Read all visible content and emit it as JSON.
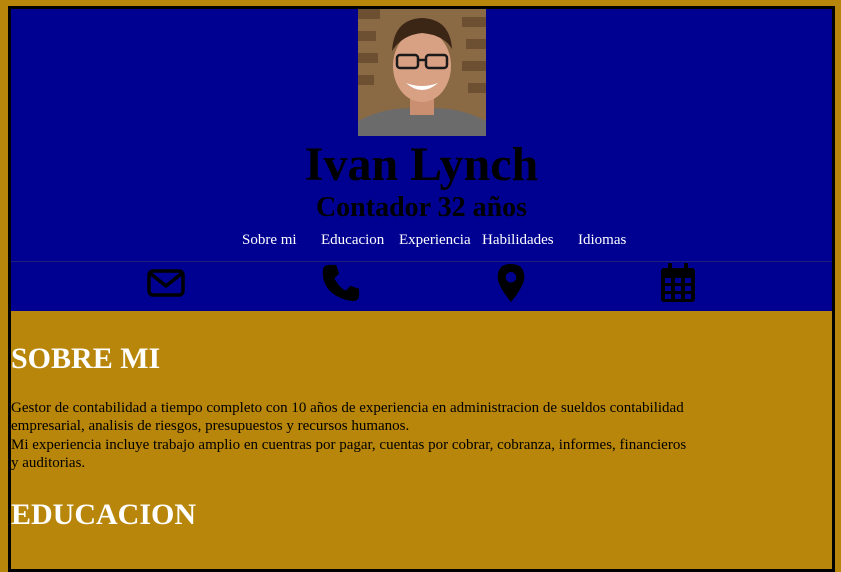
{
  "header": {
    "name": "Ivan Lynch",
    "role": "Contador 32 años"
  },
  "nav": {
    "items": [
      {
        "label": "Sobre mi"
      },
      {
        "label": "Educacion"
      },
      {
        "label": "Experiencia"
      },
      {
        "label": "Habilidades"
      },
      {
        "label": "Idiomas"
      }
    ]
  },
  "contact_icons": [
    "envelope-icon",
    "phone-icon",
    "location-pin-icon",
    "calendar-icon"
  ],
  "colors": {
    "page_background": "#b8860b",
    "header_background": "#000091",
    "section_title": "#ffffff",
    "nav_text": "#ffffff"
  },
  "sections": {
    "about": {
      "title": "SOBRE MI",
      "line1": "Gestor de contabilidad a tiempo completo con 10 años de experiencia en administracion de sueldos contabilidad empresarial, analisis de riesgos, presupuestos y recursos humanos.",
      "line2": "Mi experiencia incluye trabajo amplio en cuentras por pagar, cuentas por cobrar, cobranza, informes, financieros y auditorias."
    },
    "education": {
      "title": "EDUCACION"
    }
  }
}
